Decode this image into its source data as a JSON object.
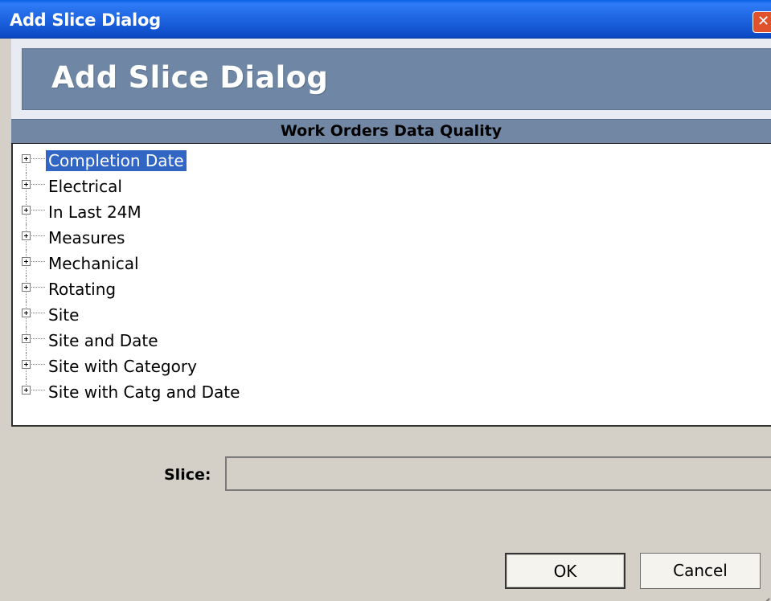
{
  "window": {
    "title": "Add Slice Dialog",
    "close_glyph": "✕"
  },
  "banner": {
    "title": "Add Slice Dialog"
  },
  "tree": {
    "header": "Work Orders Data Quality",
    "items": [
      {
        "label": "Completion Date",
        "selected": true
      },
      {
        "label": "Electrical"
      },
      {
        "label": "In Last 24M"
      },
      {
        "label": "Measures"
      },
      {
        "label": "Mechanical"
      },
      {
        "label": "Rotating"
      },
      {
        "label": "Site"
      },
      {
        "label": "Site and Date"
      },
      {
        "label": "Site with Category"
      },
      {
        "label": "Site with Catg and Date"
      }
    ]
  },
  "slice": {
    "label": "Slice:",
    "value": ""
  },
  "buttons": {
    "ok": "OK",
    "cancel": "Cancel"
  },
  "colors": {
    "title_bar": "#1a5fdc",
    "banner": "#6f87a4",
    "selection": "#3166c5",
    "dialog_bg": "#d4d0c8"
  }
}
